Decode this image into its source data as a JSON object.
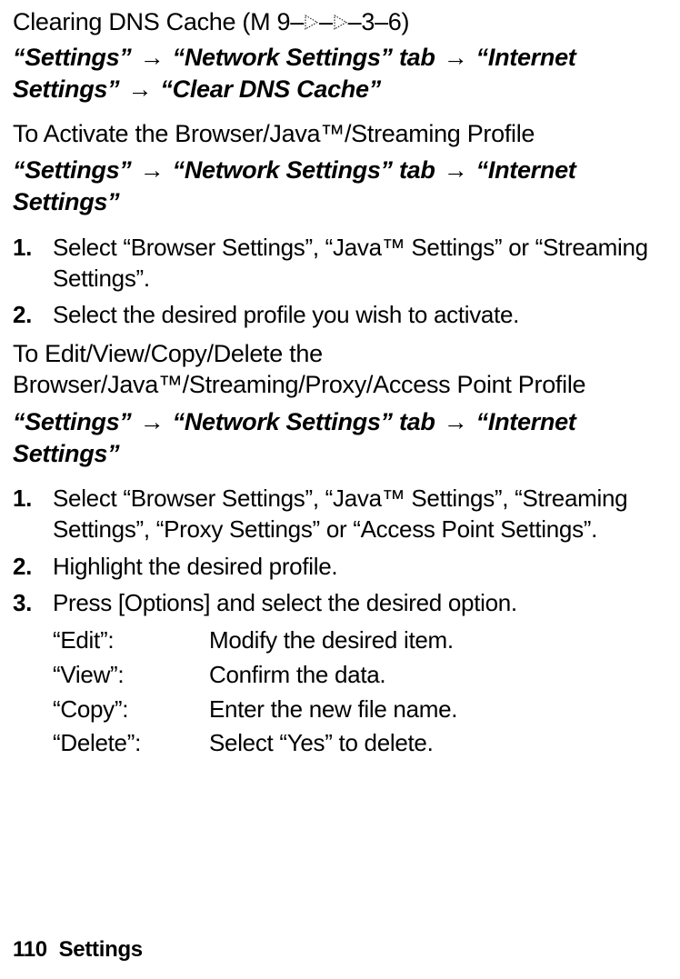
{
  "section1": {
    "heading_prefix": "Clearing DNS Cache (M 9–",
    "heading_suffix": "–3–6)",
    "path_parts": [
      "“Settings”",
      "“Network Settings” tab",
      "“Internet Settings”",
      "“Clear DNS Cache”"
    ]
  },
  "section2": {
    "subheading": "To Activate the Browser/Java™/Streaming Profile",
    "path_parts": [
      "“Settings”",
      "“Network Settings” tab",
      "“Internet Settings”"
    ],
    "steps": [
      {
        "num": "1.",
        "text": "Select “Browser Settings”, “Java™ Settings” or “Streaming Settings”."
      },
      {
        "num": "2.",
        "text": "Select the desired profile you wish to activate."
      }
    ]
  },
  "section3": {
    "subheading": "To Edit/View/Copy/Delete the Browser/Java™/Streaming/Proxy/Access Point Profile",
    "path_parts": [
      "“Settings”",
      "“Network Settings” tab",
      "“Internet Settings”"
    ],
    "steps": [
      {
        "num": "1.",
        "text": "Select “Browser Settings”, “Java™ Settings”, “Streaming Settings”, “Proxy Settings” or “Access Point Settings”."
      },
      {
        "num": "2.",
        "text": "Highlight the desired profile."
      },
      {
        "num": "3.",
        "text": "Press [Options] and select the desired option."
      }
    ],
    "options": [
      {
        "label": "“Edit”:",
        "desc": "Modify the desired item."
      },
      {
        "label": "“View”:",
        "desc": "Confirm the data."
      },
      {
        "label": "“Copy”:",
        "desc": "Enter the new file name."
      },
      {
        "label": "“Delete”:",
        "desc": "Select “Yes” to delete."
      }
    ]
  },
  "footer": {
    "page": "110",
    "label": "Settings"
  },
  "arrow": "→"
}
